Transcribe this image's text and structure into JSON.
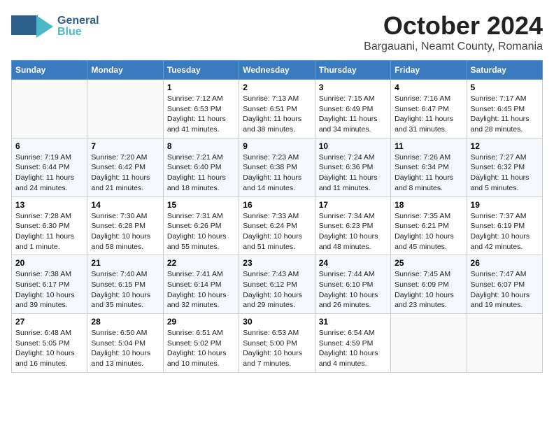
{
  "header": {
    "logo_general": "General",
    "logo_blue": "Blue",
    "month": "October 2024",
    "location": "Bargauani, Neamt County, Romania"
  },
  "days_of_week": [
    "Sunday",
    "Monday",
    "Tuesday",
    "Wednesday",
    "Thursday",
    "Friday",
    "Saturday"
  ],
  "weeks": [
    [
      {
        "day": "",
        "info": ""
      },
      {
        "day": "",
        "info": ""
      },
      {
        "day": "1",
        "info": "Sunrise: 7:12 AM\nSunset: 6:53 PM\nDaylight: 11 hours and 41 minutes."
      },
      {
        "day": "2",
        "info": "Sunrise: 7:13 AM\nSunset: 6:51 PM\nDaylight: 11 hours and 38 minutes."
      },
      {
        "day": "3",
        "info": "Sunrise: 7:15 AM\nSunset: 6:49 PM\nDaylight: 11 hours and 34 minutes."
      },
      {
        "day": "4",
        "info": "Sunrise: 7:16 AM\nSunset: 6:47 PM\nDaylight: 11 hours and 31 minutes."
      },
      {
        "day": "5",
        "info": "Sunrise: 7:17 AM\nSunset: 6:45 PM\nDaylight: 11 hours and 28 minutes."
      }
    ],
    [
      {
        "day": "6",
        "info": "Sunrise: 7:19 AM\nSunset: 6:44 PM\nDaylight: 11 hours and 24 minutes."
      },
      {
        "day": "7",
        "info": "Sunrise: 7:20 AM\nSunset: 6:42 PM\nDaylight: 11 hours and 21 minutes."
      },
      {
        "day": "8",
        "info": "Sunrise: 7:21 AM\nSunset: 6:40 PM\nDaylight: 11 hours and 18 minutes."
      },
      {
        "day": "9",
        "info": "Sunrise: 7:23 AM\nSunset: 6:38 PM\nDaylight: 11 hours and 14 minutes."
      },
      {
        "day": "10",
        "info": "Sunrise: 7:24 AM\nSunset: 6:36 PM\nDaylight: 11 hours and 11 minutes."
      },
      {
        "day": "11",
        "info": "Sunrise: 7:26 AM\nSunset: 6:34 PM\nDaylight: 11 hours and 8 minutes."
      },
      {
        "day": "12",
        "info": "Sunrise: 7:27 AM\nSunset: 6:32 PM\nDaylight: 11 hours and 5 minutes."
      }
    ],
    [
      {
        "day": "13",
        "info": "Sunrise: 7:28 AM\nSunset: 6:30 PM\nDaylight: 11 hours and 1 minute."
      },
      {
        "day": "14",
        "info": "Sunrise: 7:30 AM\nSunset: 6:28 PM\nDaylight: 10 hours and 58 minutes."
      },
      {
        "day": "15",
        "info": "Sunrise: 7:31 AM\nSunset: 6:26 PM\nDaylight: 10 hours and 55 minutes."
      },
      {
        "day": "16",
        "info": "Sunrise: 7:33 AM\nSunset: 6:24 PM\nDaylight: 10 hours and 51 minutes."
      },
      {
        "day": "17",
        "info": "Sunrise: 7:34 AM\nSunset: 6:23 PM\nDaylight: 10 hours and 48 minutes."
      },
      {
        "day": "18",
        "info": "Sunrise: 7:35 AM\nSunset: 6:21 PM\nDaylight: 10 hours and 45 minutes."
      },
      {
        "day": "19",
        "info": "Sunrise: 7:37 AM\nSunset: 6:19 PM\nDaylight: 10 hours and 42 minutes."
      }
    ],
    [
      {
        "day": "20",
        "info": "Sunrise: 7:38 AM\nSunset: 6:17 PM\nDaylight: 10 hours and 39 minutes."
      },
      {
        "day": "21",
        "info": "Sunrise: 7:40 AM\nSunset: 6:15 PM\nDaylight: 10 hours and 35 minutes."
      },
      {
        "day": "22",
        "info": "Sunrise: 7:41 AM\nSunset: 6:14 PM\nDaylight: 10 hours and 32 minutes."
      },
      {
        "day": "23",
        "info": "Sunrise: 7:43 AM\nSunset: 6:12 PM\nDaylight: 10 hours and 29 minutes."
      },
      {
        "day": "24",
        "info": "Sunrise: 7:44 AM\nSunset: 6:10 PM\nDaylight: 10 hours and 26 minutes."
      },
      {
        "day": "25",
        "info": "Sunrise: 7:45 AM\nSunset: 6:09 PM\nDaylight: 10 hours and 23 minutes."
      },
      {
        "day": "26",
        "info": "Sunrise: 7:47 AM\nSunset: 6:07 PM\nDaylight: 10 hours and 19 minutes."
      }
    ],
    [
      {
        "day": "27",
        "info": "Sunrise: 6:48 AM\nSunset: 5:05 PM\nDaylight: 10 hours and 16 minutes."
      },
      {
        "day": "28",
        "info": "Sunrise: 6:50 AM\nSunset: 5:04 PM\nDaylight: 10 hours and 13 minutes."
      },
      {
        "day": "29",
        "info": "Sunrise: 6:51 AM\nSunset: 5:02 PM\nDaylight: 10 hours and 10 minutes."
      },
      {
        "day": "30",
        "info": "Sunrise: 6:53 AM\nSunset: 5:00 PM\nDaylight: 10 hours and 7 minutes."
      },
      {
        "day": "31",
        "info": "Sunrise: 6:54 AM\nSunset: 4:59 PM\nDaylight: 10 hours and 4 minutes."
      },
      {
        "day": "",
        "info": ""
      },
      {
        "day": "",
        "info": ""
      }
    ]
  ]
}
